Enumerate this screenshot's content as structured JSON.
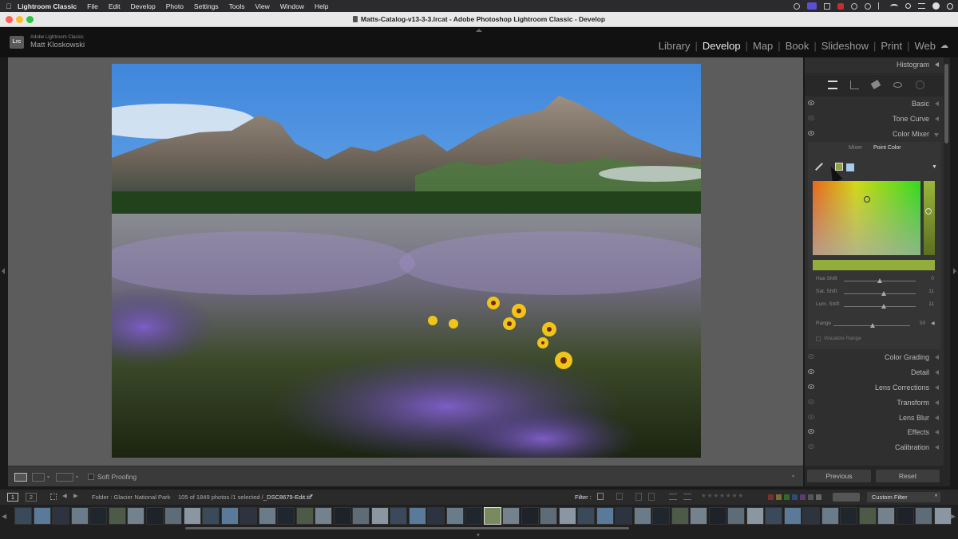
{
  "menubar": {
    "app": "Lightroom Classic",
    "items": [
      "File",
      "Edit",
      "Develop",
      "Photo",
      "Settings",
      "Tools",
      "View",
      "Window",
      "Help"
    ]
  },
  "window": {
    "title": "Matts-Catalog-v13-3-3.lrcat - Adobe Photoshop Lightroom Classic - Develop"
  },
  "identity": {
    "badge": "Lrc",
    "product": "Adobe Lightroom Classic",
    "user": "Matt Kloskowski"
  },
  "modules": [
    "Library",
    "Develop",
    "Map",
    "Book",
    "Slideshow",
    "Print",
    "Web"
  ],
  "active_module": "Develop",
  "toolbar": {
    "soft_proofing": "Soft Proofing"
  },
  "panel": {
    "histogram": "Histogram",
    "sections_top": [
      "Basic",
      "Tone Curve",
      "Color Mixer"
    ],
    "color_mixer": {
      "tabs": [
        "Mixer",
        "Point Color"
      ],
      "active_tab": "Point Color",
      "sliders": [
        {
          "label": "Hue Shift",
          "value": "0"
        },
        {
          "label": "Sat. Shift",
          "value": "11"
        },
        {
          "label": "Lum. Shift",
          "value": "11"
        }
      ],
      "range": {
        "label": "Range",
        "value": "50"
      },
      "visualize": "Visualize Range"
    },
    "sections_bottom": [
      "Color Grading",
      "Detail",
      "Lens Corrections",
      "Transform",
      "Lens Blur",
      "Effects",
      "Calibration"
    ],
    "buttons": {
      "previous": "Previous",
      "reset": "Reset"
    }
  },
  "filmstrip": {
    "page1": "1",
    "page2": "2",
    "folder": "Folder : Glacier National Park",
    "count": "105 of 1849 photos /1 selected /",
    "filename": "_DSC8679-Edit.tif",
    "filter_label": "Filter :",
    "custom_filter": "Custom Filter"
  }
}
